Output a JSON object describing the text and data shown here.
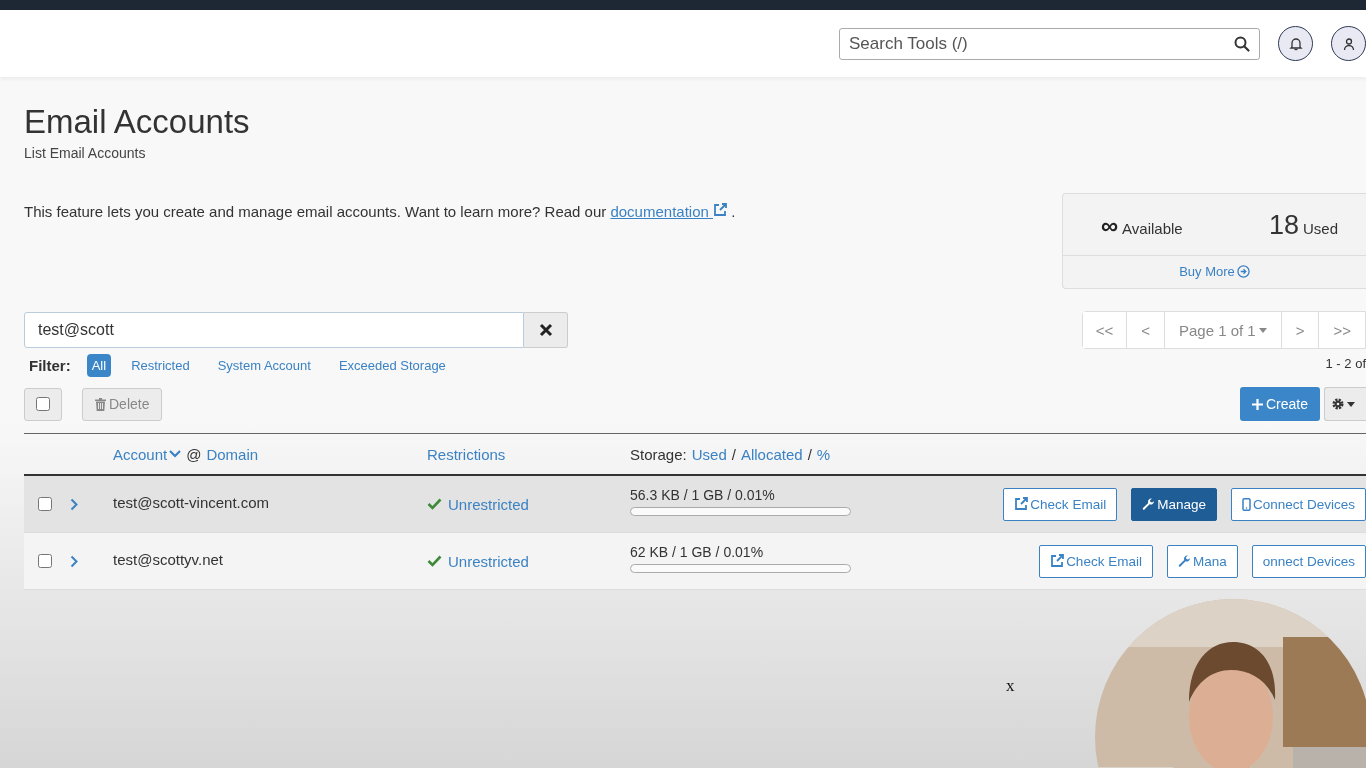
{
  "header": {
    "search": {
      "placeholder": "Search Tools (/)"
    }
  },
  "page": {
    "title": "Email Accounts",
    "subtitle": "List Email Accounts",
    "description": "This feature lets you create and manage email accounts. Want to learn more? Read our",
    "link": "documentation",
    "description_end": "."
  },
  "stats": {
    "available_value": "∞",
    "available_label": "Available",
    "used_value": "18",
    "used_label": "Used",
    "buy_more": "Buy More"
  },
  "search": {
    "value": "test@scott"
  },
  "filter": {
    "label": "Filter:",
    "options": [
      {
        "label": "All",
        "selected": true
      },
      {
        "label": "Restricted",
        "selected": false
      },
      {
        "label": "System Account",
        "selected": false
      },
      {
        "label": "Exceeded Storage",
        "selected": false
      }
    ]
  },
  "pagination": {
    "first": "<<",
    "prev": "<",
    "page": "Page 1 of 1",
    "next": ">",
    "last": ">>",
    "range": "1 - 2 of"
  },
  "toolbar": {
    "select_all_checked": false,
    "delete": "Delete",
    "create": "Create"
  },
  "table": {
    "account_header": "Account",
    "at": "@",
    "domain_header": "Domain",
    "restrictions_header": "Restrictions",
    "storage_header": [
      {
        "text": "Storage:",
        "kind": "label"
      },
      {
        "text": "Used",
        "kind": "link"
      },
      {
        "text": "/",
        "kind": "label"
      },
      {
        "text": "Allocated",
        "kind": "link"
      },
      {
        "text": "/",
        "kind": "label"
      },
      {
        "text": "%",
        "kind": "link"
      }
    ],
    "rows": [
      {
        "checked": false,
        "hover": true,
        "account": "test@scott-vincent.com",
        "restriction": "Unrestricted",
        "storage": "56.3 KB / 1 GB / 0.01%",
        "level": 0.0001,
        "buttons": [
          {
            "label": "Check Email",
            "kind": "external",
            "primary": false
          },
          {
            "label": "Manage",
            "kind": "wrench",
            "primary": true
          },
          {
            "label": "Connect Devices",
            "kind": "phone",
            "primary": false
          }
        ]
      },
      {
        "checked": false,
        "hover": false,
        "account": "test@scottyv.net",
        "restriction": "Unrestricted",
        "storage": "62 KB / 1 GB / 0.01%",
        "level": 0.0001,
        "buttons": [
          {
            "label": "Check Email",
            "kind": "external",
            "primary": false
          },
          {
            "label": "Mana",
            "kind": "wrench",
            "primary": false
          },
          {
            "label": "onnect Devices",
            "kind": "none",
            "primary": false
          }
        ]
      }
    ]
  },
  "marker": "x"
}
